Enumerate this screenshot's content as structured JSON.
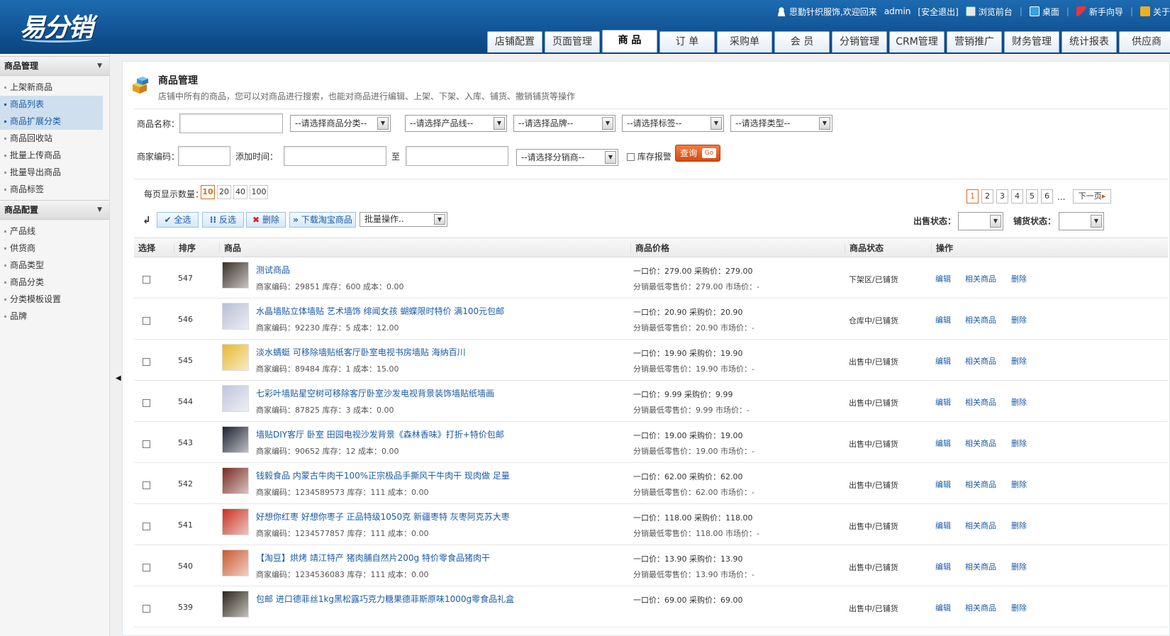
{
  "header": {
    "logo": "易分销",
    "welcome": "思勤针织服饰,欢迎回来",
    "user": "admin",
    "logout": "[安全退出]",
    "front": "浏览前台",
    "desktop": "桌面",
    "guide": "新手向导",
    "about": "关于"
  },
  "nav": [
    "店铺配置",
    "页面管理",
    "商 品",
    "订 单",
    "采购单",
    "会 员",
    "分销管理",
    "CRM管理",
    "营销推广",
    "财务管理",
    "统计报表",
    "供应商"
  ],
  "sidebar": {
    "group1": "商品管理",
    "items1": [
      "上架新商品",
      "商品列表",
      "商品扩展分类",
      "商品回收站",
      "批量上传商品",
      "批量导出商品",
      "商品标签"
    ],
    "group2": "商品配置",
    "items2": [
      "产品线",
      "供货商",
      "商品类型",
      "商品分类",
      "分类模板设置",
      "品牌"
    ]
  },
  "page": {
    "title": "商品管理",
    "desc": "店铺中所有的商品，您可以对商品进行搜索，也能对商品进行编辑、上架、下架、入库、铺货、撤销铺货等操作"
  },
  "filter": {
    "name_label": "商品名称：",
    "cat": "--请选择商品分类--",
    "line": "--请选择产品线--",
    "brand": "--请选择品牌--",
    "tag": "--请选择标签--",
    "type": "--请选择类型--",
    "code_label": "商家编码：",
    "time_label": "添加时间：",
    "to": "至",
    "dist": "--请选择分销商--",
    "stock_alert": "库存报警",
    "search": "查询",
    "go": "Go"
  },
  "toolbar": {
    "per_page_label": "每页显示数量：",
    "sizes": [
      "10",
      "20",
      "40",
      "100"
    ],
    "pages": [
      "1",
      "2",
      "3",
      "4",
      "5",
      "6"
    ],
    "ellipsis": "...",
    "next": "下一页",
    "select_all": "全选",
    "invert": "反选",
    "delete": "删除",
    "download": "下载淘宝商品",
    "batch": "批量操作..",
    "sale_status": "出售状态：",
    "dist_status": "铺货状态："
  },
  "table": {
    "headers": [
      "选择",
      "排序",
      "商品",
      "商品价格",
      "商品状态",
      "操作"
    ],
    "ops": [
      "编辑",
      "相关商品",
      "删除"
    ],
    "rows": [
      {
        "sort": "547",
        "name": "测试商品",
        "code": "商家编码：29851",
        "stock": "库存：600",
        "cost": "成本：0.00",
        "p1": "一口价：279.00  采购价：279.00",
        "p2": "分销最低零售价：279.00  市场价：-",
        "status": "下架区/已铺货",
        "thumb": "#3a3028"
      },
      {
        "sort": "546",
        "name": "水晶墙贴立体墙贴 艺术墙饰 绯闻女孩 蝴蝶限时特价 满100元包邮",
        "code": "商家编码：92230",
        "stock": "库存：5",
        "cost": "成本：12.00",
        "p1": "一口价：20.90  采购价：20.90",
        "p2": "分销最低零售价：20.90  市场价：-",
        "status": "仓库中/已铺货",
        "thumb": "#b8bfd6"
      },
      {
        "sort": "545",
        "name": "淡水蜻蜓 可移除墙贴纸客厅卧室电视书房墙贴 海纳百川",
        "code": "商家编码：89484",
        "stock": "库存：1",
        "cost": "成本：15.00",
        "p1": "一口价：19.90  采购价：19.90",
        "p2": "分销最低零售价：19.90  市场价：-",
        "status": "出售中/已铺货",
        "thumb": "#e8b830"
      },
      {
        "sort": "544",
        "name": "七彩叶墙贴星空树可移除客厅卧室沙发电视背景装饰墙贴纸墙画",
        "code": "商家编码：87825",
        "stock": "库存：3",
        "cost": "成本：0.00",
        "p1": "一口价：9.99  采购价：9.99",
        "p2": "分销最低零售价：9.99  市场价：-",
        "status": "出售中/已铺货",
        "thumb": "#c0c6dc"
      },
      {
        "sort": "543",
        "name": "墙贴DIY客厅 卧室 田园电视沙发背景《森林香味》打折+特价包邮",
        "code": "商家编码：90652",
        "stock": "库存：12",
        "cost": "成本：0.00",
        "p1": "一口价：19.00  采购价：19.00",
        "p2": "分销最低零售价：19.00  市场价：-",
        "status": "出售中/已铺货",
        "thumb": "#1c2030"
      },
      {
        "sort": "542",
        "name": "钱毅食品 内蒙古牛肉干100%正宗极品手撕风干牛肉干 现肉做 足量",
        "code": "商家编码：1234589573",
        "stock": "库存：111",
        "cost": "成本：0.00",
        "p1": "一口价：62.00  采购价：62.00",
        "p2": "分销最低零售价：62.00  市场价：-",
        "status": "出售中/已铺货",
        "thumb": "#7a2a20"
      },
      {
        "sort": "541",
        "name": "好想你红枣 好想你枣子 正品特级1050克 新疆枣特 灰枣阿克苏大枣",
        "code": "商家编码：1234577857",
        "stock": "库存：111",
        "cost": "成本：0.00",
        "p1": "一口价：118.00  采购价：118.00",
        "p2": "分销最低零售价：118.00  市场价：-",
        "status": "出售中/已铺货",
        "thumb": "#c83020"
      },
      {
        "sort": "540",
        "name": "【淘豆】烘烤 靖江特产 猪肉脯自然片200g 特价零食品猪肉干",
        "code": "商家编码：1234536083",
        "stock": "库存：111",
        "cost": "成本：0.00",
        "p1": "一口价：13.90  采购价：13.90",
        "p2": "分销最低零售价：13.90  市场价：-",
        "status": "出售中/已铺货",
        "thumb": "#c85a30"
      },
      {
        "sort": "539",
        "name": "包邮 进口德菲丝1kg黑松露巧克力糖果德菲斯原味1000g零食品礼盒",
        "code": "",
        "stock": "",
        "cost": "",
        "p1": "一口价：69.00  采购价：69.00",
        "p2": "",
        "status": "出售中/已铺货",
        "thumb": "#2a2418"
      }
    ]
  }
}
